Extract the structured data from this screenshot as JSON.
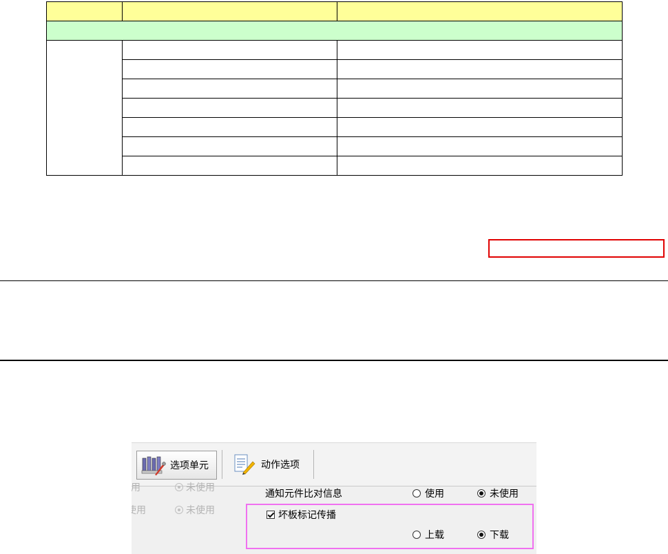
{
  "table": {
    "header": [
      "",
      "",
      ""
    ],
    "section": "",
    "rows": [
      [
        "",
        ""
      ],
      [
        "",
        ""
      ],
      [
        "",
        ""
      ],
      [
        "",
        ""
      ],
      [
        "",
        ""
      ],
      [
        "",
        ""
      ],
      [
        "",
        ""
      ]
    ]
  },
  "screenshot": {
    "toolbar": {
      "option_unit_label": "选项单元",
      "action_option_label": "动作选项"
    },
    "faded": {
      "row1_left": "用",
      "row1_right": "未使用",
      "row2_left": "使用",
      "row2_right": "未使用"
    },
    "notify": {
      "label": "通知元件比对信息",
      "use": "使用",
      "not_use": "未使用",
      "selected": "not_use"
    },
    "badmark": {
      "label": "坏板标记传播",
      "checked": true,
      "upload": "上载",
      "download": "下载",
      "selected": "download"
    }
  },
  "colors": {
    "table_header": "#ffff99",
    "table_section": "#ccffcc",
    "red_box": "#e00000",
    "pink_box": "#f070f0"
  }
}
